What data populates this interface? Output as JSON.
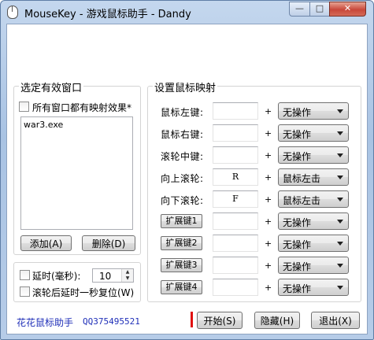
{
  "window": {
    "title": "MouseKey - 游戏鼠标助手 - Dandy",
    "minimize_glyph": "—",
    "maximize_glyph": "□",
    "close_glyph": "✕"
  },
  "left_panel": {
    "group_title": "选定有效窗口",
    "all_windows_checkbox_label": "所有窗口都有映射效果*",
    "all_windows_checked": false,
    "window_list": [
      "war3.exe"
    ],
    "add_button": "添加(A)",
    "delete_button": "删除(D)"
  },
  "delay_panel": {
    "delay_checkbox_label": "延时(毫秒):",
    "delay_checked": false,
    "delay_value": "10",
    "reset_checkbox_label": "滚轮后延时一秒复位(W)",
    "reset_checked": false,
    "spin_up": "▲",
    "spin_down": "▼"
  },
  "mapping": {
    "group_title": "设置鼠标映射",
    "plus": "+",
    "rows": [
      {
        "label": "鼠标左键:",
        "key": "",
        "action": "无操作"
      },
      {
        "label": "鼠标右键:",
        "key": "",
        "action": "无操作"
      },
      {
        "label": "滚轮中键:",
        "key": "",
        "action": "无操作"
      },
      {
        "label": "向上滚轮:",
        "key": "R",
        "action": "鼠标左击"
      },
      {
        "label": "向下滚轮:",
        "key": "F",
        "action": "鼠标左击"
      },
      {
        "label": "扩展键1",
        "key": "",
        "action": "无操作"
      },
      {
        "label": "扩展键2",
        "key": "",
        "action": "无操作"
      },
      {
        "label": "扩展键3",
        "key": "",
        "action": "无操作"
      },
      {
        "label": "扩展键4",
        "key": "",
        "action": "无操作"
      }
    ]
  },
  "footer": {
    "app_link": "花花鼠标助手",
    "qq": "QQ375495521",
    "start_button": "开始(S)",
    "hide_button": "隐藏(H)",
    "exit_button": "退出(X)"
  },
  "colors": {
    "accent_red": "#e01010",
    "link_blue": "#1f2fb8"
  }
}
